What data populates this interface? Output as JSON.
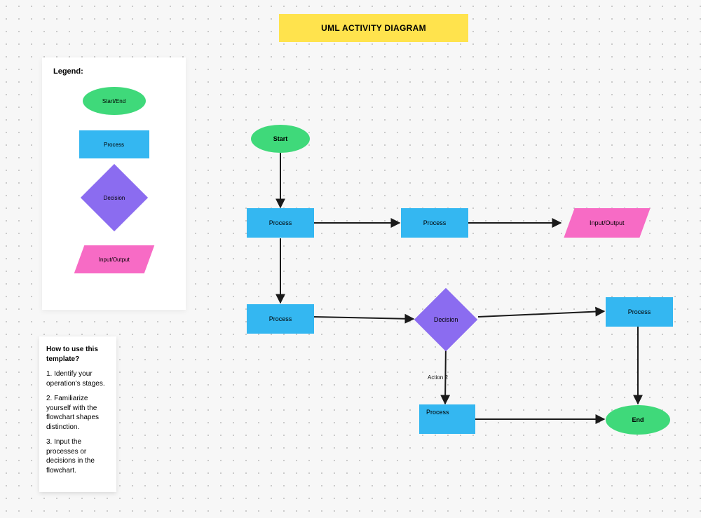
{
  "title": "UML ACTIVITY DIAGRAM",
  "legend": {
    "heading": "Legend:",
    "start_end": "Start/End",
    "process": "Process",
    "decision": "Decision",
    "io": "Input/Output"
  },
  "howto": {
    "heading": "How to use this template?",
    "step1": "1. Identify your operation's stages.",
    "step2": "2. Familiarize yourself with the flowchart shapes distinction.",
    "step3": "3. Input the processes or decisions in the flowchart."
  },
  "nodes": {
    "start": "Start",
    "p1": "Process",
    "p2": "Process",
    "io1": "Input/Output",
    "p3": "Process",
    "decision": "Decision",
    "p4": "Process",
    "p5": "Process",
    "end": "End"
  },
  "edges": {
    "action2": "Action 2"
  },
  "chart_data": {
    "type": "flowchart",
    "title": "UML ACTIVITY DIAGRAM",
    "nodes": [
      {
        "id": "start",
        "shape": "ellipse",
        "label": "Start"
      },
      {
        "id": "p1",
        "shape": "rect",
        "label": "Process"
      },
      {
        "id": "p2",
        "shape": "rect",
        "label": "Process"
      },
      {
        "id": "io1",
        "shape": "parallelogram",
        "label": "Input/Output"
      },
      {
        "id": "p3",
        "shape": "rect",
        "label": "Process"
      },
      {
        "id": "decision",
        "shape": "diamond",
        "label": "Decision"
      },
      {
        "id": "p4",
        "shape": "rect",
        "label": "Process"
      },
      {
        "id": "p5",
        "shape": "rect",
        "label": "Process"
      },
      {
        "id": "end",
        "shape": "ellipse",
        "label": "End"
      }
    ],
    "edges": [
      {
        "from": "start",
        "to": "p1"
      },
      {
        "from": "p1",
        "to": "p2"
      },
      {
        "from": "p2",
        "to": "io1"
      },
      {
        "from": "p1",
        "to": "p3"
      },
      {
        "from": "p3",
        "to": "decision"
      },
      {
        "from": "decision",
        "to": "p4"
      },
      {
        "from": "decision",
        "to": "p5",
        "label": "Action 2"
      },
      {
        "from": "p5",
        "to": "end"
      },
      {
        "from": "p4",
        "to": "end"
      }
    ],
    "legend": [
      {
        "shape": "ellipse",
        "label": "Start/End",
        "color": "#3fd97a"
      },
      {
        "shape": "rect",
        "label": "Process",
        "color": "#34b7f1"
      },
      {
        "shape": "diamond",
        "label": "Decision",
        "color": "#8b6cf0"
      },
      {
        "shape": "parallelogram",
        "label": "Input/Output",
        "color": "#f76bc5"
      }
    ]
  }
}
